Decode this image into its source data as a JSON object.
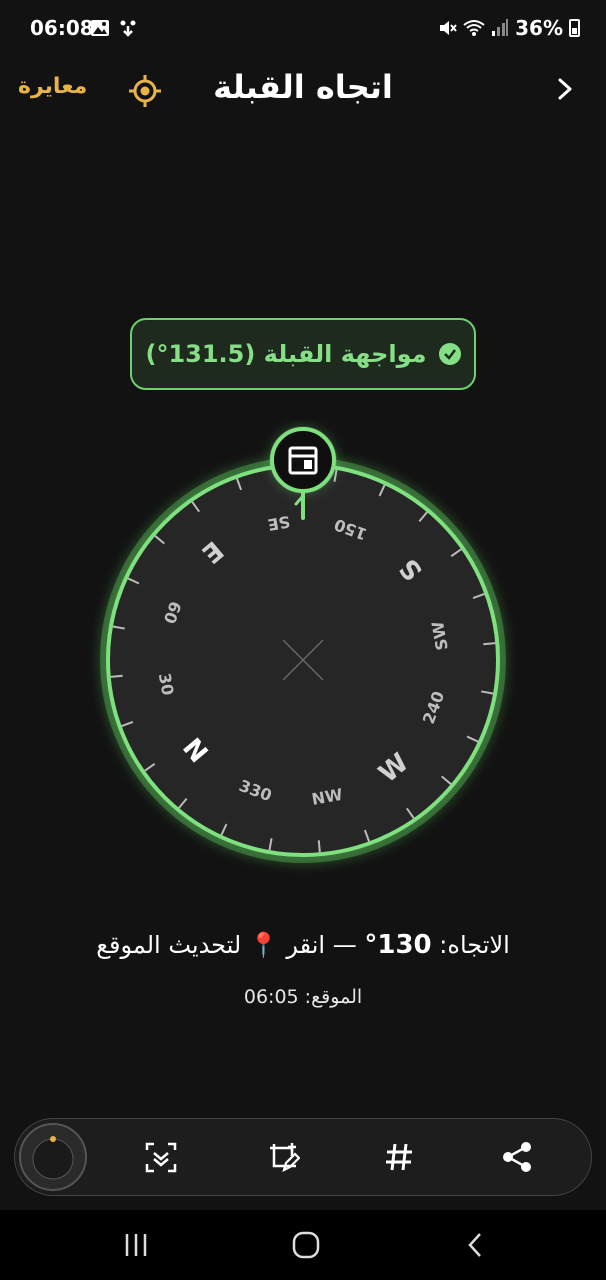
{
  "status_bar": {
    "time": "06:08",
    "battery": "36%"
  },
  "header": {
    "title": "اتجاه القبلة",
    "calibrate_label": "معايرة"
  },
  "qibla_badge": {
    "text": "مواجهة القبلة (131.5°)"
  },
  "compass": {
    "labels": [
      {
        "text": "N",
        "angle": -130,
        "major": true
      },
      {
        "text": "30",
        "angle": -100,
        "major": false
      },
      {
        "text": "60",
        "angle": -70,
        "major": false
      },
      {
        "text": "E",
        "angle": -40,
        "major": true
      },
      {
        "text": "SE",
        "angle": -10,
        "major": false
      },
      {
        "text": "150",
        "angle": 20,
        "major": false
      },
      {
        "text": "S",
        "angle": 50,
        "major": true
      },
      {
        "text": "SW",
        "angle": 80,
        "major": false
      },
      {
        "text": "240",
        "angle": 110,
        "major": false
      },
      {
        "text": "W",
        "angle": 140,
        "major": true
      },
      {
        "text": "NW",
        "angle": 170,
        "major": false
      },
      {
        "text": "330",
        "angle": -160,
        "major": false
      }
    ],
    "accent_color": "#7ee07e"
  },
  "info": {
    "heading_prefix": "الاتجاه:",
    "heading_value": "130°",
    "heading_suffix": "— انقر 📍 لتحديث الموقع",
    "location_label": "الموقع:",
    "location_time": "06:05"
  },
  "toolbar": {
    "icons": [
      "scan-icon",
      "edit-icon",
      "hashtag-icon",
      "share-icon"
    ]
  }
}
